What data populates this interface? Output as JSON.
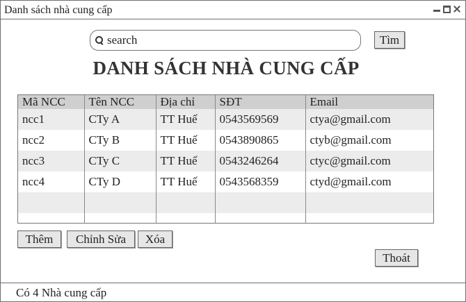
{
  "window": {
    "title": "Danh sách nhà cung cấp"
  },
  "search": {
    "placeholder": "search",
    "value": "",
    "button_label": "Tìm"
  },
  "heading": "DANH SÁCH NHÀ CUNG CẤP",
  "table": {
    "columns": [
      "Mã NCC",
      "Tên NCC",
      "Địa chỉ",
      "SĐT",
      "Email"
    ],
    "rows": [
      [
        "ncc1",
        "CTy A",
        "TT Huế",
        "0543569569",
        "ctya@gmail.com"
      ],
      [
        "ncc2",
        "CTy B",
        "TT Huế",
        "0543890865",
        "ctyb@gmail.com"
      ],
      [
        "ncc3",
        "CTy C",
        "TT Huế",
        "0543246264",
        "ctyc@gmail.com"
      ],
      [
        "ncc4",
        "CTy D",
        "TT Huế",
        "0543568359",
        "ctyd@gmail.com"
      ]
    ]
  },
  "actions": {
    "add": "Thêm",
    "edit": "Chỉnh Sửa",
    "delete": "Xóa",
    "exit": "Thoát"
  },
  "status": "Có 4 Nhà cung cấp"
}
